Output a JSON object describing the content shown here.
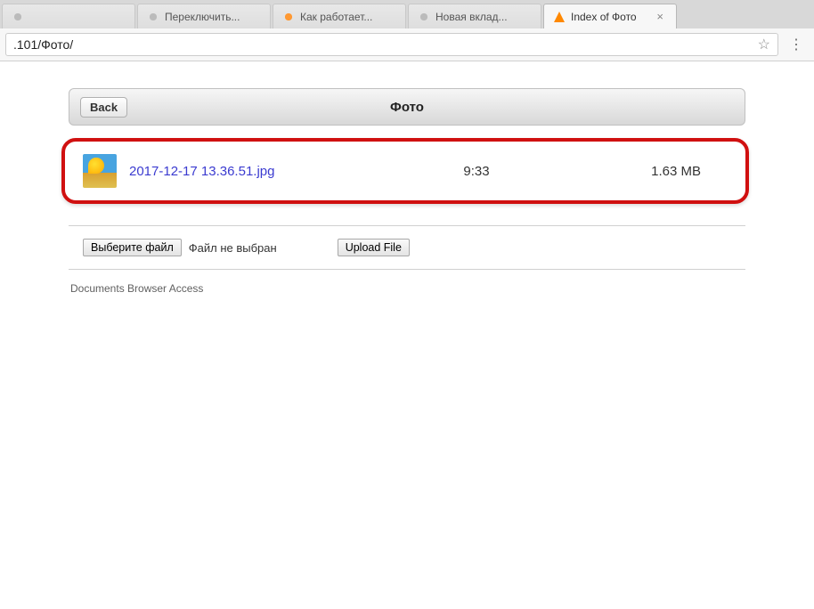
{
  "browser": {
    "tabs": [
      {
        "title": "",
        "active": false,
        "favicon": "gray"
      },
      {
        "title": "Переключить...",
        "active": false,
        "favicon": "gray"
      },
      {
        "title": "Как работает...",
        "active": false,
        "favicon": "orange"
      },
      {
        "title": "Новая вклад...",
        "active": false,
        "favicon": "gray"
      },
      {
        "title": "Index of Фото",
        "active": true,
        "favicon": "vlc"
      }
    ],
    "url": ".101/Фото/"
  },
  "page": {
    "back_label": "Back",
    "title": "Фото",
    "files": [
      {
        "name": "2017-12-17 13.36.51.jpg",
        "time": "9:33",
        "size": "1.63 MB"
      }
    ],
    "choose_file_label": "Выберите файл",
    "no_file_chosen": "Файл не выбран",
    "upload_label": "Upload File",
    "footer": "Documents Browser Access"
  }
}
